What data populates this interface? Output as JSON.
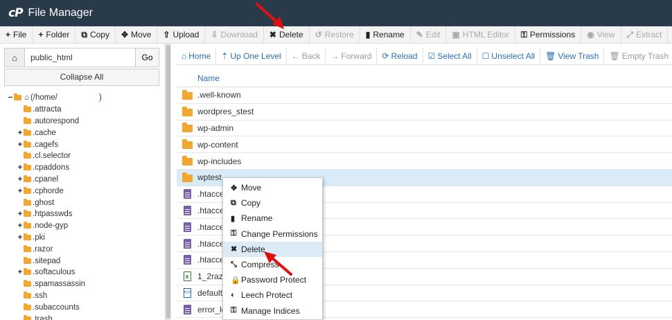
{
  "app": {
    "logo": "cP",
    "title": "File Manager"
  },
  "toolbar": [
    {
      "icon": "+",
      "label": "File",
      "disabled": false
    },
    {
      "icon": "+",
      "label": "Folder",
      "disabled": false
    },
    {
      "icon": "⧉",
      "label": "Copy",
      "disabled": false
    },
    {
      "icon": "✥",
      "label": "Move",
      "disabled": false
    },
    {
      "icon": "⇧",
      "label": "Upload",
      "disabled": false
    },
    {
      "icon": "⇩",
      "label": "Download",
      "disabled": true
    },
    {
      "icon": "✖",
      "label": "Delete",
      "disabled": false
    },
    {
      "icon": "↺",
      "label": "Restore",
      "disabled": true
    },
    {
      "icon": "▮",
      "label": "Rename",
      "disabled": false
    },
    {
      "icon": "✎",
      "label": "Edit",
      "disabled": true
    },
    {
      "icon": "▣",
      "label": "HTML Editor",
      "disabled": true
    },
    {
      "icon": "⚿",
      "label": "Permissions",
      "disabled": false
    },
    {
      "icon": "◉",
      "label": "View",
      "disabled": true
    },
    {
      "icon": "⤢",
      "label": "Extract",
      "disabled": true
    }
  ],
  "left": {
    "path_value": "public_html",
    "go_label": "Go",
    "collapse_label": "Collapse All",
    "root_label": "(/home/",
    "root_suffix": ")",
    "tree": [
      {
        "toggle": "",
        "label": ".attracta"
      },
      {
        "toggle": "",
        "label": ".autorespond"
      },
      {
        "toggle": "+",
        "label": ".cache"
      },
      {
        "toggle": "+",
        "label": ".cagefs"
      },
      {
        "toggle": "",
        "label": ".cl.selector"
      },
      {
        "toggle": "+",
        "label": ".cpaddons"
      },
      {
        "toggle": "+",
        "label": ".cpanel"
      },
      {
        "toggle": "+",
        "label": ".cphorde"
      },
      {
        "toggle": "",
        "label": ".ghost"
      },
      {
        "toggle": "+",
        "label": ".htpasswds"
      },
      {
        "toggle": "+",
        "label": ".node-gyp"
      },
      {
        "toggle": "+",
        "label": ".pki"
      },
      {
        "toggle": "",
        "label": ".razor"
      },
      {
        "toggle": "",
        "label": ".sitepad"
      },
      {
        "toggle": "+",
        "label": ".softaculous"
      },
      {
        "toggle": "",
        "label": ".spamassassin"
      },
      {
        "toggle": "",
        "label": ".ssh"
      },
      {
        "toggle": "",
        "label": ".subaccounts"
      },
      {
        "toggle": "",
        "label": ".trash"
      }
    ]
  },
  "navbar": [
    {
      "icon": "⌂",
      "label": "Home",
      "disabled": false
    },
    {
      "icon": "⇡",
      "label": "Up One Level",
      "disabled": false
    },
    {
      "icon": "←",
      "label": "Back",
      "disabled": true
    },
    {
      "icon": "→",
      "label": "Forward",
      "disabled": true
    },
    {
      "icon": "⟳",
      "label": "Reload",
      "disabled": false
    },
    {
      "icon": "☑",
      "label": "Select All",
      "disabled": false
    },
    {
      "icon": "☐",
      "label": "Unselect All",
      "disabled": false
    },
    {
      "icon": "🗑",
      "label": "View Trash",
      "disabled": false
    },
    {
      "icon": "🗑",
      "label": "Empty Trash",
      "disabled": true
    }
  ],
  "list": {
    "header": "Name",
    "rows": [
      {
        "type": "folder",
        "name": ".well-known",
        "selected": false
      },
      {
        "type": "folder",
        "name": "wordpres_stest",
        "selected": false
      },
      {
        "type": "folder",
        "name": "wp-admin",
        "selected": false
      },
      {
        "type": "folder",
        "name": "wp-content",
        "selected": false
      },
      {
        "type": "folder",
        "name": "wp-includes",
        "selected": false
      },
      {
        "type": "folder",
        "name": "wptest",
        "selected": true
      },
      {
        "type": "file",
        "name": ".htacces",
        "selected": false
      },
      {
        "type": "file",
        "name": ".htacces",
        "selected": false
      },
      {
        "type": "file",
        "name": ".htacces",
        "selected": false
      },
      {
        "type": "file",
        "name": ".htacces",
        "selected": false
      },
      {
        "type": "file",
        "name": ".htacces",
        "selected": false
      },
      {
        "type": "xls",
        "name": "1_2raz.",
        "selected": false
      },
      {
        "type": "code",
        "name": "default.l",
        "selected": false
      },
      {
        "type": "file",
        "name": "error_lo",
        "selected": false
      }
    ]
  },
  "context_menu": [
    {
      "icon": "✥",
      "label": "Move",
      "highlighted": false
    },
    {
      "icon": "⧉",
      "label": "Copy",
      "highlighted": false
    },
    {
      "icon": "▮",
      "label": "Rename",
      "highlighted": false
    },
    {
      "icon": "⚿",
      "label": "Change Permissions",
      "highlighted": false
    },
    {
      "icon": "✖",
      "label": "Delete",
      "highlighted": true
    },
    {
      "icon": "⤡",
      "label": "Compress",
      "highlighted": false
    },
    {
      "icon": "🔒",
      "label": "Password Protect",
      "highlighted": false
    },
    {
      "icon": "◐",
      "label": "Leech Protect",
      "highlighted": false
    },
    {
      "icon": "⚿",
      "label": "Manage Indices",
      "highlighted": false
    }
  ],
  "colors": {
    "titlebar": "#293a4a",
    "link": "#2a6fb5",
    "folder": "#f0a830",
    "selected_row": "#d9ebf7",
    "arrow": "#e01010"
  }
}
